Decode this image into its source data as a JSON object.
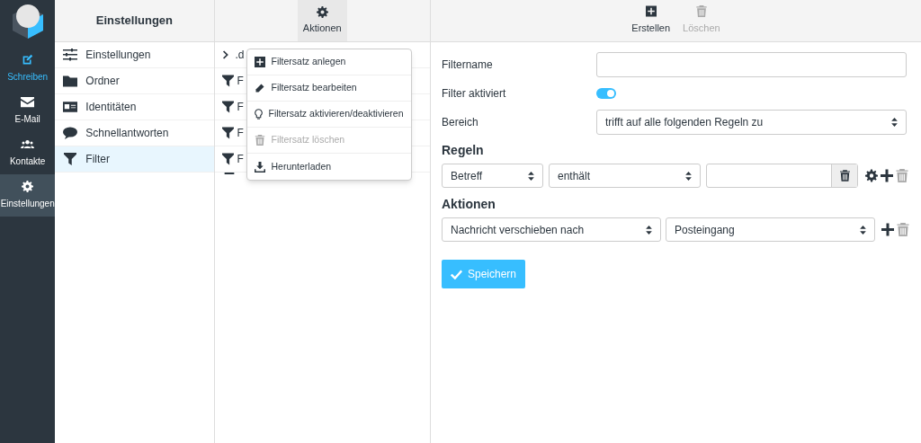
{
  "nav": [
    {
      "label": "Schreiben",
      "kind": "compose",
      "selected": false
    },
    {
      "label": "E-Mail",
      "kind": "link",
      "selected": false
    },
    {
      "label": "Kontakte",
      "kind": "link",
      "selected": false
    },
    {
      "label": "Einstellungen",
      "kind": "link",
      "selected": true
    }
  ],
  "settings": {
    "title": "Einstellungen",
    "items": [
      {
        "label": "Einstellungen",
        "selected": false
      },
      {
        "label": "Ordner",
        "selected": false
      },
      {
        "label": "Identitäten",
        "selected": false
      },
      {
        "label": "Schnellantworten",
        "selected": false
      },
      {
        "label": "Filter",
        "selected": true
      }
    ]
  },
  "filter_sets": {
    "toolbar_button": "Aktionen",
    "rows": [
      {
        "kind": "folder",
        "text": ".d"
      },
      {
        "kind": "filter",
        "text": "F"
      },
      {
        "kind": "filter",
        "text": "F"
      },
      {
        "kind": "filter",
        "text": "F"
      },
      {
        "kind": "filter",
        "text": "F"
      },
      {
        "kind": "dash"
      }
    ]
  },
  "actions_menu": [
    {
      "label": "Filtersatz anlegen",
      "disabled": false
    },
    {
      "label": "Filtersatz bearbeiten",
      "disabled": false
    },
    {
      "label": "Filtersatz aktivieren/deaktivieren",
      "disabled": false
    },
    {
      "label": "Filtersatz löschen",
      "disabled": true
    },
    {
      "label": "Herunterladen",
      "disabled": false
    }
  ],
  "editor": {
    "toolbar": [
      {
        "label": "Erstellen",
        "disabled": false
      },
      {
        "label": "Löschen",
        "disabled": true
      }
    ],
    "filtername_label": "Filtername",
    "filter_enabled_label": "Filter aktiviert",
    "filter_enabled": {
      "on": true
    },
    "scope_label": "Bereich",
    "scope_value": "trifft auf alle folgenden Regeln zu",
    "rules_heading": "Regeln",
    "rule": {
      "header": "Betreff",
      "operator": "enthält"
    },
    "actions_heading": "Aktionen",
    "action": {
      "type": "Nachricht verschieben nach",
      "target": "Posteingang"
    },
    "save_button": "Speichern"
  }
}
